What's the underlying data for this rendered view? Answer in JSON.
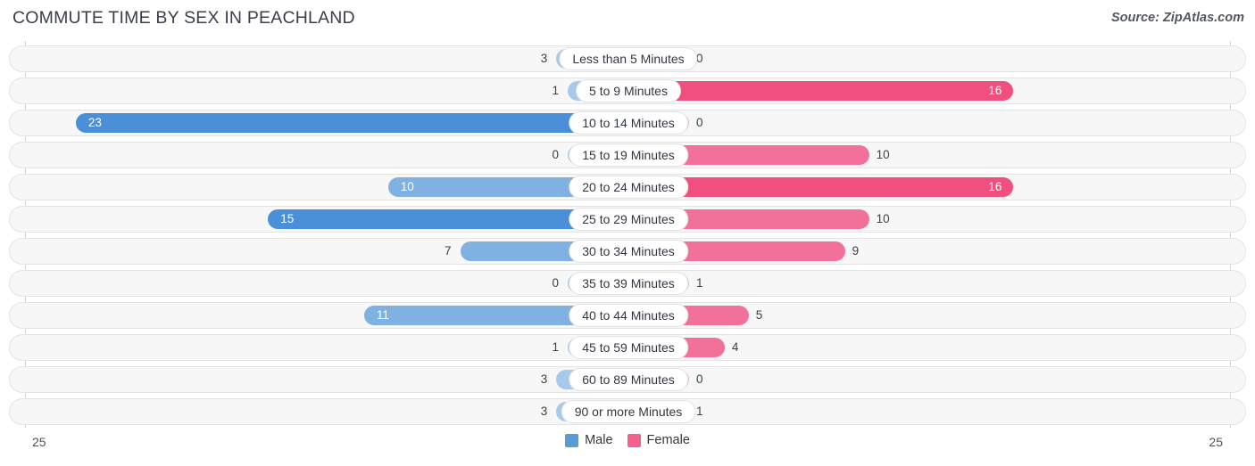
{
  "header": {
    "title": "COMMUTE TIME BY SEX IN PEACHLAND",
    "source": "Source: ZipAtlas.com"
  },
  "axis": {
    "left_max_label": "25",
    "right_max_label": "25",
    "max": 25
  },
  "legend": {
    "items": [
      {
        "label": "Male",
        "color": "#5b9bd5"
      },
      {
        "label": "Female",
        "color": "#f2628f"
      }
    ]
  },
  "colors": {
    "male_strong": "#4a90d9",
    "male_mid": "#7fb2e2",
    "male_light": "#a8c9ea",
    "female_strong": "#f04f80",
    "female_mid": "#f2719b",
    "female_light": "#f7a9c4",
    "row_bg": "#f7f7f7",
    "row_border": "#e4e4e4",
    "gridline": "#d6d6d6",
    "text": "#33373f"
  },
  "chart_data": {
    "type": "bar",
    "subtype": "diverging-bidirectional",
    "title": "COMMUTE TIME BY SEX IN PEACHLAND",
    "xlabel": "",
    "ylabel": "",
    "xlim": [
      -25,
      25
    ],
    "axis_max": 25,
    "grid": true,
    "legend_position": "bottom-center",
    "categories": [
      "Less than 5 Minutes",
      "5 to 9 Minutes",
      "10 to 14 Minutes",
      "15 to 19 Minutes",
      "20 to 24 Minutes",
      "25 to 29 Minutes",
      "30 to 34 Minutes",
      "35 to 39 Minutes",
      "40 to 44 Minutes",
      "45 to 59 Minutes",
      "60 to 89 Minutes",
      "90 or more Minutes"
    ],
    "series": [
      {
        "name": "Male",
        "side": "left",
        "values": [
          3,
          1,
          23,
          0,
          10,
          15,
          7,
          0,
          11,
          1,
          3,
          3
        ]
      },
      {
        "name": "Female",
        "side": "right",
        "values": [
          0,
          16,
          0,
          10,
          16,
          10,
          9,
          1,
          5,
          4,
          0,
          1
        ]
      }
    ]
  },
  "rows": [
    {
      "category": "Less than 5 Minutes",
      "male": 3,
      "male_label": "3",
      "female": 0,
      "female_label": "0"
    },
    {
      "category": "5 to 9 Minutes",
      "male": 1,
      "male_label": "1",
      "female": 16,
      "female_label": "16"
    },
    {
      "category": "10 to 14 Minutes",
      "male": 23,
      "male_label": "23",
      "female": 0,
      "female_label": "0"
    },
    {
      "category": "15 to 19 Minutes",
      "male": 0,
      "male_label": "0",
      "female": 10,
      "female_label": "10"
    },
    {
      "category": "20 to 24 Minutes",
      "male": 10,
      "male_label": "10",
      "female": 16,
      "female_label": "16"
    },
    {
      "category": "25 to 29 Minutes",
      "male": 15,
      "male_label": "15",
      "female": 10,
      "female_label": "10"
    },
    {
      "category": "30 to 34 Minutes",
      "male": 7,
      "male_label": "7",
      "female": 9,
      "female_label": "9"
    },
    {
      "category": "35 to 39 Minutes",
      "male": 0,
      "male_label": "0",
      "female": 1,
      "female_label": "1"
    },
    {
      "category": "40 to 44 Minutes",
      "male": 11,
      "male_label": "11",
      "female": 5,
      "female_label": "5"
    },
    {
      "category": "45 to 59 Minutes",
      "male": 1,
      "male_label": "1",
      "female": 4,
      "female_label": "4"
    },
    {
      "category": "60 to 89 Minutes",
      "male": 3,
      "male_label": "3",
      "female": 0,
      "female_label": "0"
    },
    {
      "category": "90 or more Minutes",
      "male": 3,
      "male_label": "3",
      "female": 1,
      "female_label": "1"
    }
  ]
}
